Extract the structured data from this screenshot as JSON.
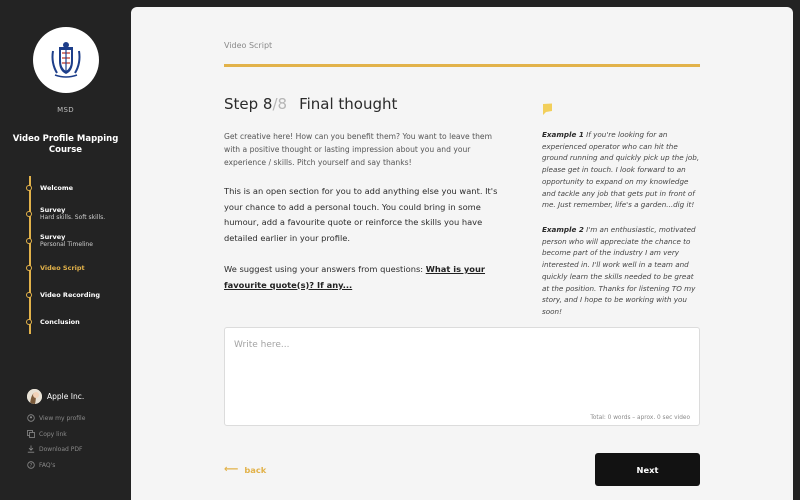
{
  "sidebar": {
    "org": "MSD",
    "course_title": "Video Profile Mapping Course",
    "nav": [
      {
        "label": "Welcome",
        "sub": ""
      },
      {
        "label": "Survey",
        "sub": "Hard skills. Soft skills."
      },
      {
        "label": "Survey",
        "sub": "Personal Timeline"
      },
      {
        "label": "Video Script",
        "sub": "",
        "active": true
      },
      {
        "label": "Video Recording",
        "sub": ""
      },
      {
        "label": "Conclusion",
        "sub": ""
      }
    ],
    "user_name": "Apple Inc.",
    "links": [
      {
        "label": "View my profile",
        "icon": "user-icon"
      },
      {
        "label": "Copy link",
        "icon": "copy-icon"
      },
      {
        "label": "Download PDF",
        "icon": "download-icon"
      },
      {
        "label": "FAQ's",
        "icon": "help-icon"
      }
    ]
  },
  "main": {
    "breadcrumb": "Video Script",
    "step_label": "Step 8",
    "step_total": "/8",
    "step_title": "Final thought",
    "intro": "Get creative here! How can you benefit them? You want to leave them with a positive thought or lasting impression about you and your experience / skills. Pitch yourself and say thanks!",
    "body1": "This is an open section for you to add anything else you want. It's your chance to add a personal touch. You could bring in some humour, add a favourite quote or reinforce the skills you have detailed earlier in your profile.",
    "body2_prefix": "We suggest using your answers from questions:",
    "body2_link": "What is your favourite quote(s)? If any...",
    "examples": [
      {
        "title": "Example 1",
        "text": "If you're looking for an experienced operator who can hit the ground running and quickly pick up the job, please get in touch. I look forward to an opportunity to expand on my knowledge and tackle any job that gets put in front of me. Just remember, life's a garden...dig it!"
      },
      {
        "title": "Example 2",
        "text": "I'm an enthusiastic, motivated person who will appreciate the chance to become part of the industry I am very interested in. I'll work well in a team and quickly learn the skills needed to be great at the position. Thanks for listening TO my story, and I hope to be working with you soon!"
      }
    ],
    "textarea_placeholder": "Write here...",
    "counter": "Total: 0 words – aprox. 0 sec video",
    "back_label": "back",
    "next_label": "Next"
  },
  "colors": {
    "accent": "#e2b24a",
    "sidebar_bg": "#232323",
    "button_bg": "#121212"
  }
}
